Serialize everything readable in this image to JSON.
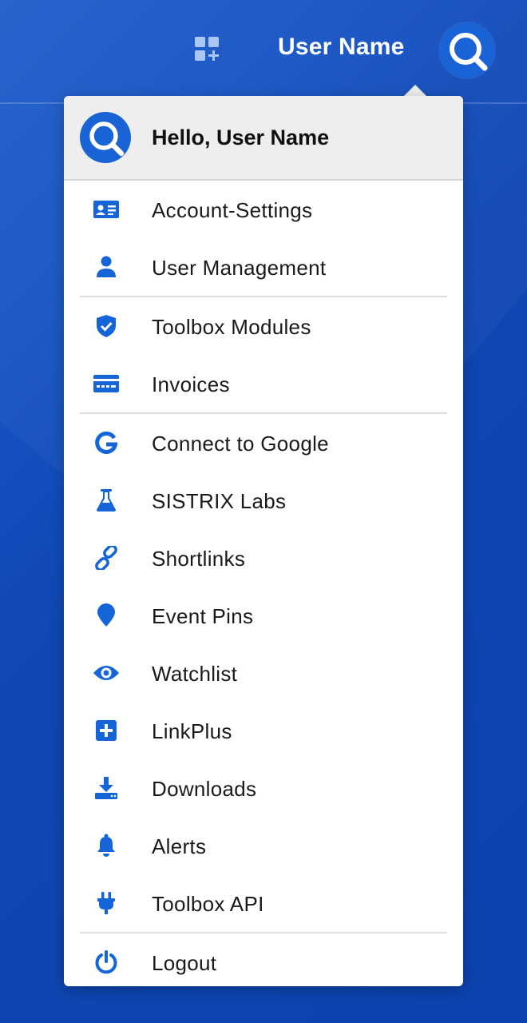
{
  "topbar": {
    "user_name": "User Name",
    "apps_icon": "grid-plus-icon",
    "avatar_icon": "magnifier-logo-icon"
  },
  "menu": {
    "greeting": "Hello, User Name",
    "groups": [
      [
        {
          "label": "Account-Settings",
          "icon": "id-card-icon"
        },
        {
          "label": "User Management",
          "icon": "user-icon"
        }
      ],
      [
        {
          "label": "Toolbox Modules",
          "icon": "shield-check-icon"
        },
        {
          "label": "Invoices",
          "icon": "credit-card-icon"
        }
      ],
      [
        {
          "label": "Connect to Google",
          "icon": "google-icon"
        },
        {
          "label": "SISTRIX Labs",
          "icon": "flask-icon"
        },
        {
          "label": "Shortlinks",
          "icon": "link-icon"
        },
        {
          "label": "Event Pins",
          "icon": "map-pin-icon"
        },
        {
          "label": "Watchlist",
          "icon": "eye-icon"
        },
        {
          "label": "LinkPlus",
          "icon": "plus-square-icon"
        },
        {
          "label": "Downloads",
          "icon": "download-icon"
        },
        {
          "label": "Alerts",
          "icon": "bell-icon"
        },
        {
          "label": "Toolbox API",
          "icon": "plug-icon"
        }
      ],
      [
        {
          "label": "Logout",
          "icon": "power-icon"
        }
      ]
    ]
  },
  "colors": {
    "background": "#0d44b0",
    "icon": "#1565d8",
    "header_bg": "#eeeeee",
    "text": "#1a1a1a"
  }
}
